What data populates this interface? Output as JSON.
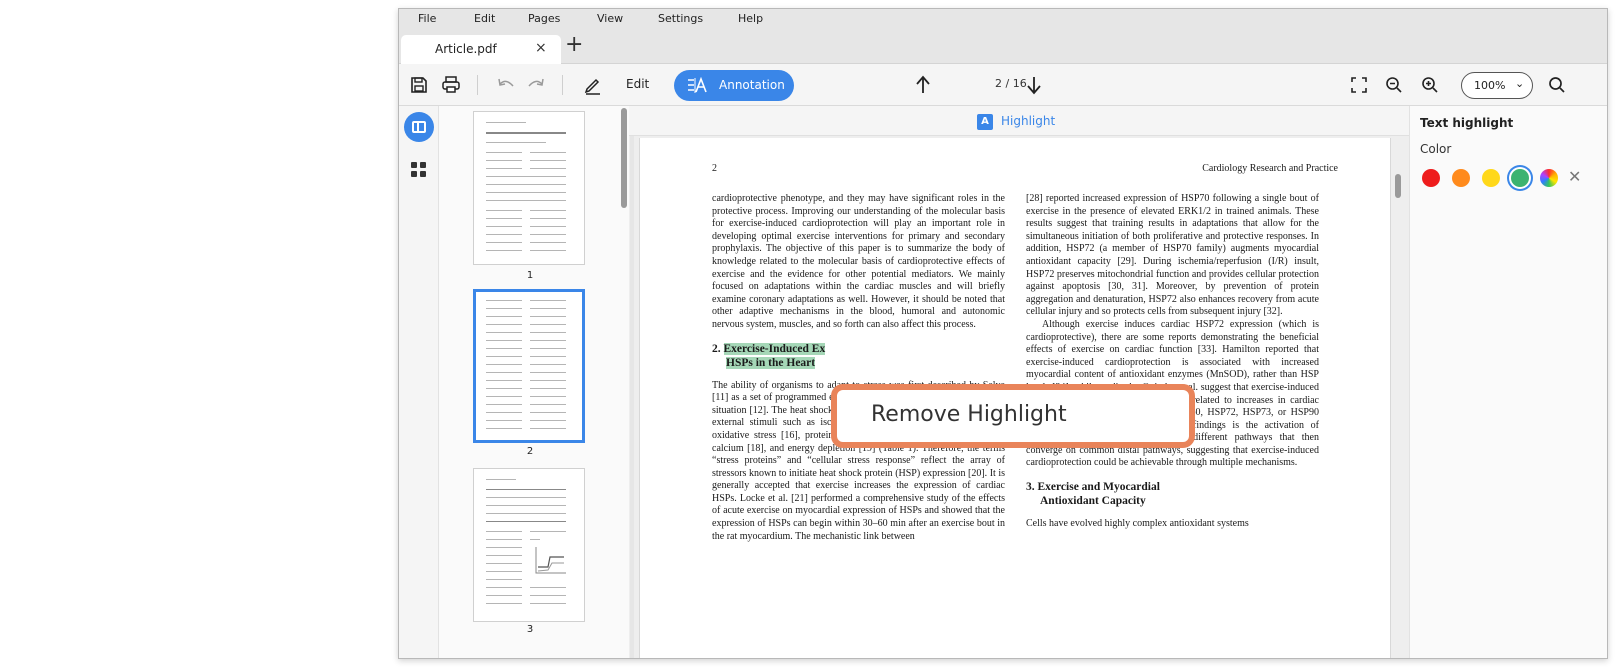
{
  "menu": [
    "File",
    "Edit",
    "Pages",
    "View",
    "Settings",
    "Help"
  ],
  "tab": {
    "title": "Article.pdf",
    "close": "×",
    "add": "+"
  },
  "toolbar": {
    "edit_label": "Edit",
    "annotation_label": "Annotation",
    "page_indicator": "2 / 16",
    "zoom": "100%",
    "zoom_caret": "⌄"
  },
  "highlight_bar": {
    "badge": "A",
    "label": "Highlight"
  },
  "thumbnails": [
    {
      "number": "1"
    },
    {
      "number": "2"
    },
    {
      "number": "3"
    }
  ],
  "page": {
    "number": "2",
    "running_head": "Cardiology Research and Practice",
    "left_para1": "cardioprotective phenotype, and they may have significant roles in the protective process. Improving our understanding of the molecular basis for exercise-induced cardioprotection will play an important role in developing optimal exercise interventions for primary and secondary prophylaxis. The objective of this paper is to summarize the body of knowledge related to the molecular basis of cardioprotective effects of exercise and the evidence for other potential mediators. We mainly focused on adaptations within the cardiac muscles and will briefly examine coronary adaptations as well. However, it should be noted that other adaptive mechanisms in the blood, humoral and autonomic nervous system, muscles, and so forth can also affect this process.",
    "sec2_num": "2.",
    "sec2_line1": "Exercise-Induced Ex",
    "sec2_line2": "HSPs in the Heart",
    "left_para2": "The ability of organisms to adapt to stress was first described by Selye [11] as a set of programmed events that help organisms to cope with the situation [12]. The heat shock response is a common cellular reaction to external stimuli such as ischemia [13], hypoxia [14], acidosis [15], oxidative stress [16], protein degradation [17], increased intracellular calcium [18], and energy depletion [19] (Table 1). Therefore, the terms “stress proteins” and “cellular stress response” reflect the array of stressors known to initiate heat shock protein (HSP) expression [20]. It is generally accepted that exercise increases the expression of cardiac HSPs. Locke et al. [21] performed a comprehensive study of the effects of acute exercise on myocardial expression of HSPs and showed that the expression of HSPs can begin within 30–60 min after an exercise bout in the rat myocardium. The mechanistic link between",
    "right_para1": "[28] reported increased expression of HSP70 following a single bout of exercise in the presence of elevated ERK1/2 in trained animals. These results suggest that training results in adaptations that allow for the simultaneous initiation of both proliferative and protective responses. In addition, HSP72 (a member of HSP70 family) augments myocardial antioxidant capacity [29]. During ischemia/reperfusion (I/R) insult, HSP72 preserves mitochondrial function and provides cellular protection against apoptosis [30, 31]. Moreover, by prevention of protein aggregation and denaturation, HSP72 also enhances recovery from acute cellular injury and so protects cells from subsequent injury [32].",
    "right_para2": "Although exercise induces cardiac HSP72 expression (which is cardioprotective), there are some reports demonstrating the beneficial effects of exercise on cardiac function [33]. Hamilton reported that exercise-induced cardioprotection is associated with increased myocardial content of antioxidant enzymes (MnSOD), rather than HSP levels [34], while studies by Quindry et al. suggest that exercise-induced myocardial protection against I/R is unrelated to increases in cardiac levels of HSP10, HSP27, HSP40, HSP60, HSP72, HSP73, or HSP90 [35, 36]. One explanation for these findings is the activation of cardioprotective mechanisms through different pathways that then converge on common distal pathways, suggesting that exercise-induced cardioprotection could be achievable through multiple mechanisms.",
    "sec3_num": "3.",
    "sec3_line1": "Exercise and Myocardial",
    "sec3_line2": "Antioxidant Capacity",
    "right_para3": "Cells have evolved highly complex antioxidant systems"
  },
  "popup": {
    "label": "Remove Highlight"
  },
  "right_panel": {
    "title": "Text highlight",
    "color_label": "Color",
    "swatches": [
      "#ee1c1c",
      "#ff8a1c",
      "#ffd81a",
      "#3cb371"
    ],
    "clear": "✕"
  }
}
